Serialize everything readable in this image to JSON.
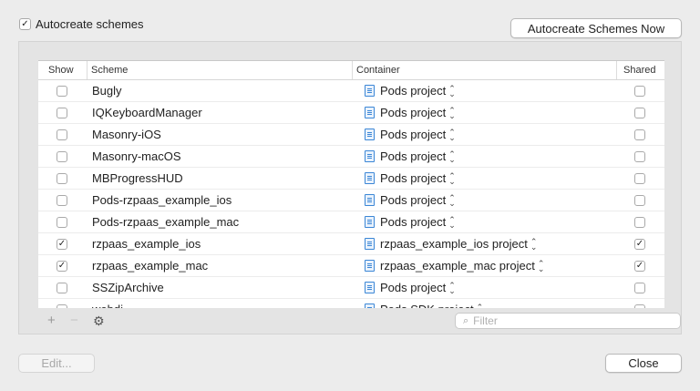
{
  "autocreate": {
    "label": "Autocreate schemes",
    "checked": true
  },
  "buttons": {
    "autocreate_now": "Autocreate Schemes Now",
    "edit": "Edit...",
    "close": "Close"
  },
  "table": {
    "headers": {
      "show": "Show",
      "scheme": "Scheme",
      "container": "Container",
      "shared": "Shared"
    },
    "rows": [
      {
        "show": false,
        "scheme": "Bugly",
        "container": "Pods project",
        "shared": false
      },
      {
        "show": false,
        "scheme": "IQKeyboardManager",
        "container": "Pods project",
        "shared": false
      },
      {
        "show": false,
        "scheme": "Masonry-iOS",
        "container": "Pods project",
        "shared": false
      },
      {
        "show": false,
        "scheme": "Masonry-macOS",
        "container": "Pods project",
        "shared": false
      },
      {
        "show": false,
        "scheme": "MBProgressHUD",
        "container": "Pods project",
        "shared": false
      },
      {
        "show": false,
        "scheme": "Pods-rzpaas_example_ios",
        "container": "Pods project",
        "shared": false
      },
      {
        "show": false,
        "scheme": "Pods-rzpaas_example_mac",
        "container": "Pods project",
        "shared": false
      },
      {
        "show": true,
        "scheme": "rzpaas_example_ios",
        "container": "rzpaas_example_ios project",
        "shared": true
      },
      {
        "show": true,
        "scheme": "rzpaas_example_mac",
        "container": "rzpaas_example_mac project",
        "shared": true
      },
      {
        "show": false,
        "scheme": "SSZipArchive",
        "container": "Pods project",
        "shared": false
      },
      {
        "show": false,
        "scheme": "webdi...",
        "container": "Pods SDK project",
        "shared": false
      }
    ]
  },
  "toolbar": {
    "add_glyph": "+",
    "remove_glyph": "−",
    "gear_glyph": "⚙"
  },
  "filter": {
    "placeholder": "Filter",
    "value": ""
  },
  "icons": {
    "project": "xcode-project-icon",
    "stepper": "up-down-stepper-icon",
    "search": "search-icon"
  },
  "colors": {
    "accent": "#3b86d6",
    "background": "#ececec"
  }
}
